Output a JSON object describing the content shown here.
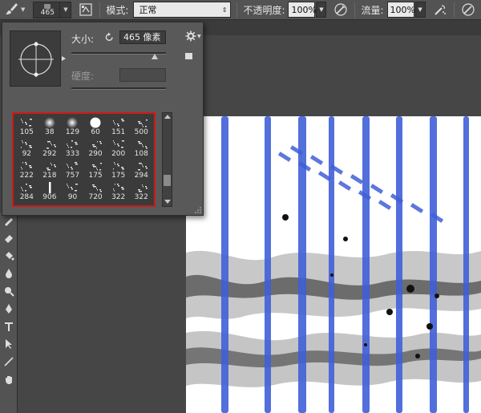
{
  "options_bar": {
    "brush_size": "465",
    "mode_label": "模式:",
    "mode_value": "正常",
    "opacity_label": "不透明度:",
    "opacity_value": "100%",
    "flow_label": "流量:",
    "flow_value": "100%"
  },
  "brush_panel": {
    "size_label": "大小:",
    "size_value": "465 像素",
    "hardness_label": "硬度:",
    "presets": [
      {
        "size": "105",
        "kind": "grunge"
      },
      {
        "size": "38",
        "kind": "soft"
      },
      {
        "size": "129",
        "kind": "soft"
      },
      {
        "size": "60",
        "kind": "hard"
      },
      {
        "size": "151",
        "kind": "grunge"
      },
      {
        "size": "500",
        "kind": "grunge"
      },
      {
        "size": "92",
        "kind": "grunge"
      },
      {
        "size": "292",
        "kind": "grunge"
      },
      {
        "size": "333",
        "kind": "grunge"
      },
      {
        "size": "290",
        "kind": "grunge"
      },
      {
        "size": "200",
        "kind": "grunge"
      },
      {
        "size": "108",
        "kind": "grunge"
      },
      {
        "size": "222",
        "kind": "grunge"
      },
      {
        "size": "218",
        "kind": "grunge"
      },
      {
        "size": "757",
        "kind": "grunge"
      },
      {
        "size": "175",
        "kind": "grunge"
      },
      {
        "size": "175",
        "kind": "grunge"
      },
      {
        "size": "294",
        "kind": "grunge"
      },
      {
        "size": "284",
        "kind": "grunge"
      },
      {
        "size": "906",
        "kind": "stroke"
      },
      {
        "size": "90",
        "kind": "grunge"
      },
      {
        "size": "720",
        "kind": "grunge"
      },
      {
        "size": "322",
        "kind": "grunge"
      },
      {
        "size": "322",
        "kind": "grunge"
      }
    ],
    "highlight_color": "#d01818"
  },
  "canvas": {
    "stripe_color": "#3f5fd7"
  }
}
